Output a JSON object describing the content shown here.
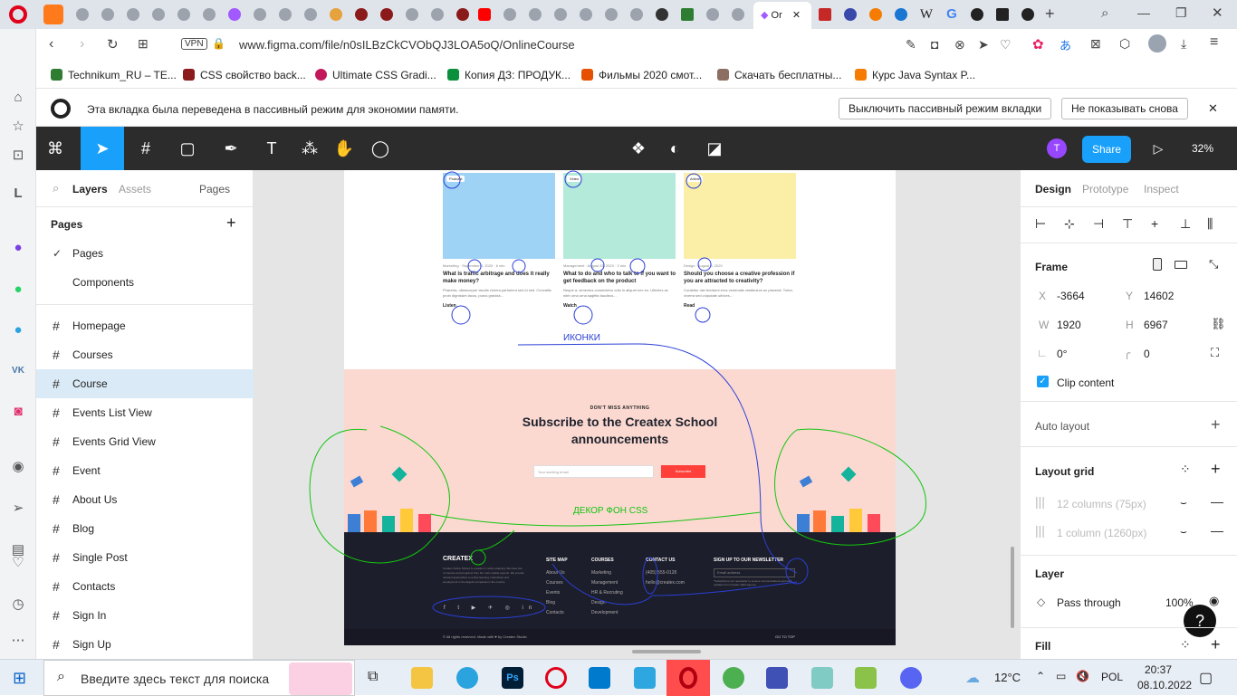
{
  "browser": {
    "active_tab_label": "Or",
    "url": "www.figma.com/file/n0sILBzCkCVObQJ3LOA5oQ/OnlineCourse",
    "vpn_label": "VPN",
    "bookmarks": [
      {
        "label": "Technikum_RU – TE...",
        "color": "#2e7d32"
      },
      {
        "label": "CSS свойство back...",
        "color": "#8b1a1a"
      },
      {
        "label": "Ultimate CSS Gradi...",
        "color": "#c2185b"
      },
      {
        "label": "Копия ДЗ: ПРОДУК...",
        "color": "#0a8f3c"
      },
      {
        "label": "Фильмы 2020 смот...",
        "color": "#e65100"
      },
      {
        "label": "Скачать бесплатны...",
        "color": "#8d6e63"
      },
      {
        "label": "Курс Java Syntax P...",
        "color": "#f57c00"
      }
    ],
    "notice_text": "Эта вкладка была переведена в пассивный режим для экономии памяти.",
    "notice_btn_1": "Выключить пассивный режим вкладки",
    "notice_btn_2": "Не показывать снова"
  },
  "figma": {
    "zoom": "32%",
    "share_label": "Share",
    "avatar_letter": "T",
    "left_tabs": {
      "layers": "Layers",
      "assets": "Assets",
      "pages": "Pages"
    },
    "pages_header": "Pages",
    "pages": [
      "Pages",
      "Components"
    ],
    "frames": [
      "Homepage",
      "Courses",
      "Course",
      "Events List View",
      "Events Grid View",
      "Event",
      "About Us",
      "Blog",
      "Single Post",
      "Contacts",
      "Sign In",
      "Sign Up"
    ],
    "selected_frame": "Course",
    "right_tabs": {
      "design": "Design",
      "prototype": "Prototype",
      "inspect": "Inspect"
    },
    "frame_section": {
      "title": "Frame",
      "x_label": "X",
      "x": "-3664",
      "y_label": "Y",
      "y": "14602",
      "w_label": "W",
      "w": "1920",
      "h_label": "H",
      "h": "6967",
      "rotation": "0°",
      "radius": "0",
      "clip_content": "Clip content"
    },
    "auto_layout": "Auto layout",
    "layout_grid": {
      "title": "Layout grid",
      "grid1": "12 columns (75px)",
      "grid2": "1 column (1260px)"
    },
    "layer": {
      "title": "Layer",
      "blend": "Pass through",
      "opacity": "100%"
    },
    "fill": "Fill"
  },
  "canvas": {
    "cards": [
      {
        "tag": "Podcast",
        "meta": "Marketing · September 4, 2020 · 6 min",
        "title": "What is traffic arbitrage and does it really make money?",
        "desc": "Pharetra, ullamcorper iaculis viverra parturient sed id sed. Convallis proin dignissim lacus, purus gravida...",
        "link": "Listen",
        "bg": "#9fd3f5"
      },
      {
        "tag": "Video",
        "meta": "Management · August 25, 2020 · 3 min",
        "title": "What to do and who to talk to if you want to get feedback on the product",
        "desc": "Neque a, senectus consectetur odio in aliquet nec eu. Ultricies ac nibh urna urna sagittis faucibus...",
        "link": "Watch",
        "bg": "#b4ead9"
      },
      {
        "tag": "Article",
        "meta": "Design · August 8, 2020",
        "title": "Should you choose a creative profession if you are attracted to creativity?",
        "desc": "Curabitur nisl tincidunt eros venenatis vestibulum ac placerat. Tortor, viverra sed vulputate ultrices...",
        "link": "Read",
        "bg": "#fbefa8"
      }
    ],
    "annotation_icons": "ИКОНКИ",
    "annotation_decor": "ДЕКОР ФОН CSS",
    "subscribe": {
      "kicker": "DON'T MISS ANYTHING",
      "title_line1": "Subscribe to the Createx School",
      "title_line2": "announcements",
      "placeholder": "Your working email",
      "button": "Subscribe"
    },
    "footer": {
      "logo": "CREATEX",
      "about": "Createx Online School is a leader in online studying. We have lots of courses and programs from the main market experts. We provide relevant approaches to online learning, internships and employment in the largest companies in the country.",
      "sitemap_title": "SITE MAP",
      "sitemap": [
        "About Us",
        "Courses",
        "Events",
        "Blog",
        "Contacts"
      ],
      "courses_title": "COURSES",
      "courses": [
        "Marketing",
        "Management",
        "HR & Recruting",
        "Design",
        "Development"
      ],
      "contact_title": "CONTACT US",
      "phone": "(405) 555-0128",
      "email": "hello@createx.com",
      "newsletter_title": "SIGN UP TO OUR NEWSLETTER",
      "newsletter_placeholder": "Email address",
      "newsletter_note": "*Subscribe to our newsletter to receive communications and early updates from Createx SEO Agency.",
      "copyright": "© All rights reserved. Made with ♥ by Createx Studio",
      "go_top": "GO TO TOP"
    }
  },
  "taskbar": {
    "search_placeholder": "Введите здесь текст для поиска",
    "weather": "12°C",
    "lang": "POL",
    "time": "20:37",
    "date": "08.10.2022"
  }
}
